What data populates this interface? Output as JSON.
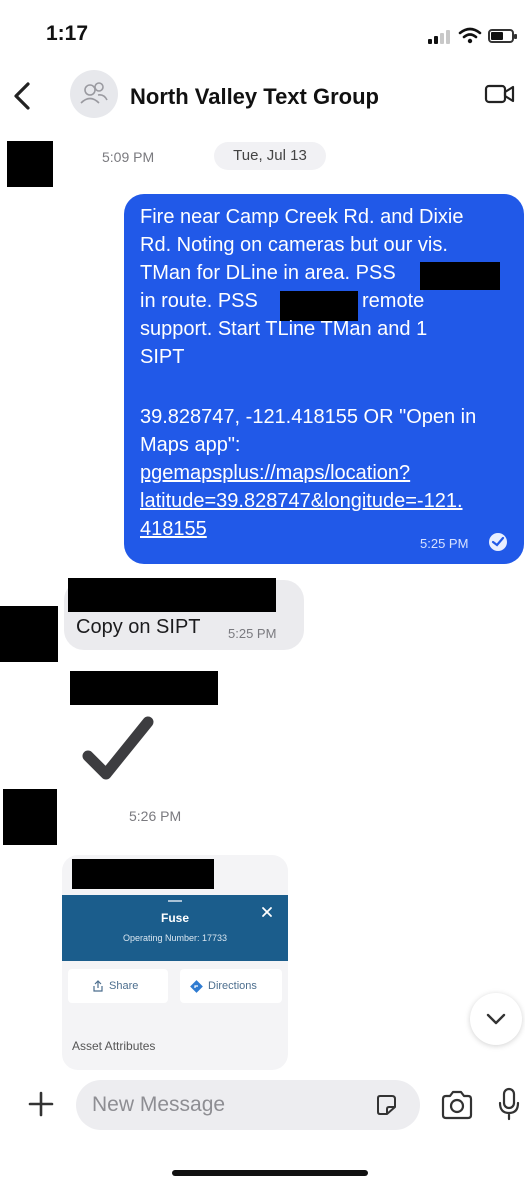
{
  "status_bar": {
    "time": "1:17"
  },
  "header": {
    "title": "North Valley Text Group"
  },
  "thread": {
    "first_time": "5:09 PM",
    "date": "Tue, Jul 13",
    "outgoing": {
      "lines": [
        "Fire near Camp Creek Rd.  and Dixie",
        "Rd.  Noting on cameras but our vis.",
        "TMan for DLine in area. PSS",
        "in route.  PSS",
        "remote",
        "support. Start TLine TMan and 1",
        "SIPT",
        "39.828747, -121.418155 OR \"Open in",
        "Maps app\":",
        "pgemapsplus://maps/location?",
        "latitude=39.828747&longitude=-121.",
        "418155"
      ],
      "time": "5:25 PM"
    },
    "reply": {
      "text": "Copy on SIPT",
      "time": "5:25 PM"
    },
    "later_time": "5:26 PM",
    "map_card": {
      "title": "Fuse",
      "subtitle": "Operating Number: 17733",
      "share_label": "Share",
      "directions_label": "Directions",
      "attributes_label": "Asset Attributes"
    }
  },
  "composer": {
    "placeholder": "New Message"
  },
  "colors": {
    "outgoing_bubble": "#2159e8",
    "incoming_bubble": "#ebebee",
    "card_banner": "#1b5d8c"
  }
}
